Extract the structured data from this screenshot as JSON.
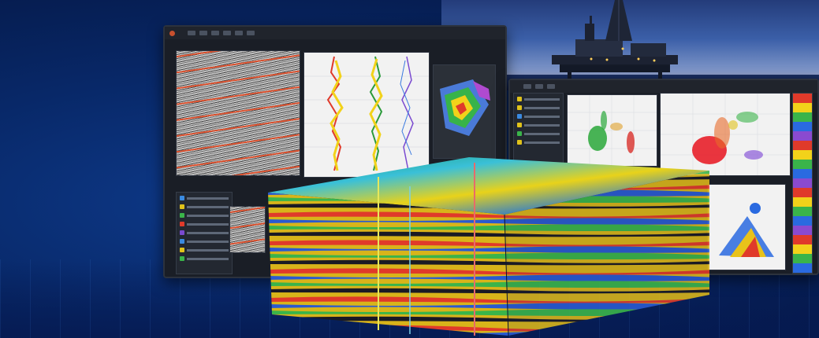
{
  "scene": {
    "description_icons": [
      "oil-rig-icon"
    ],
    "colors": {
      "background": "#082868",
      "seismic_red": "#e0461e",
      "layer_yellow": "#f2e21a",
      "layer_green": "#3cb44a",
      "layer_blue": "#1f4fc8",
      "layer_red": "#d2282a"
    }
  },
  "left_window": {
    "title": ""
  },
  "right_window": {
    "title": ""
  }
}
